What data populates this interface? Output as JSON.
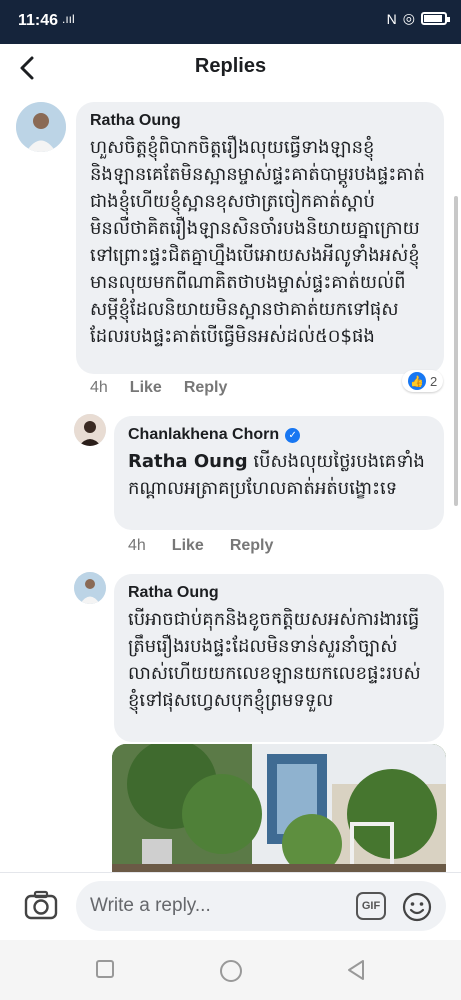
{
  "status_bar": {
    "time": "11:46",
    "signal": ".ııl"
  },
  "header": {
    "title": "Replies"
  },
  "comments": [
    {
      "author": "Ratha Oung",
      "text": "ហួសចិត្តខ្ញុំពិបាកចិត្តរឿងលុយធ្វើទាងឡានខ្ញុំនិងឡានគេតែមិនស្អានម្ចាស់ផ្ទះគាត់បាម្ដូរបងផ្ទះគាត់ជាងខ្ញុំហើយខ្ញុំស្អានខុសថាត្រចៀកគាត់ស្ដាប់មិនលឺថាគិតរឿងឡានសិនចាំរបងនិយាយគ្នាក្រោយទៅព្រោះផ្ទះជិតគ្នាហ្នឹងបើអោយសងអីលូទាំងអស់ខ្ញុំមានលុយមកពីណាគិតថាបងម្ចាស់ផ្ទះគាត់យល់ពីសម្ដីខ្ញុំដែលនិយាយមិនស្អានថាគាត់យកទៅផុសដែលរបងផ្ទះគាត់បើធ្វើមិនអស់ដល់៥០$ផង",
      "time": "4h",
      "like_label": "Like",
      "reply_label": "Reply",
      "reactions": "2"
    },
    {
      "author": "Chanlakhena Chorn",
      "verified": true,
      "mention": "Ratha Oung",
      "text": "បើសងលុយថ្លៃរបងគេទាំងកណ្ដាលអត្រាគប្រហែលគាត់អត់បង្ខោះទេ",
      "time": "4h",
      "like_label": "Like",
      "reply_label": "Reply"
    },
    {
      "author": "Ratha Oung",
      "text": "បើអាចជាប់គុកនិងខូចកត្តិយសអស់ការងារធ្វើត្រឹមរឿងរបងផ្ទះដែលមិនទាន់សួរនាំច្បាស់លាស់ហើយយកលេខឡានយកលេខផ្ទះរបស់ខ្ញុំទៅផុសហ្វេសបុកខ្ញុំព្រមទទួល"
    }
  ],
  "composer": {
    "placeholder": "Write a reply...",
    "gif_label": "GIF"
  },
  "icons": {
    "back": "back-arrow-icon",
    "camera": "camera-icon",
    "emoji": "emoji-icon"
  },
  "colors": {
    "status_bar_bg": "#15243b",
    "bubble_bg": "#eef0f3",
    "accent": "#1877f2"
  }
}
